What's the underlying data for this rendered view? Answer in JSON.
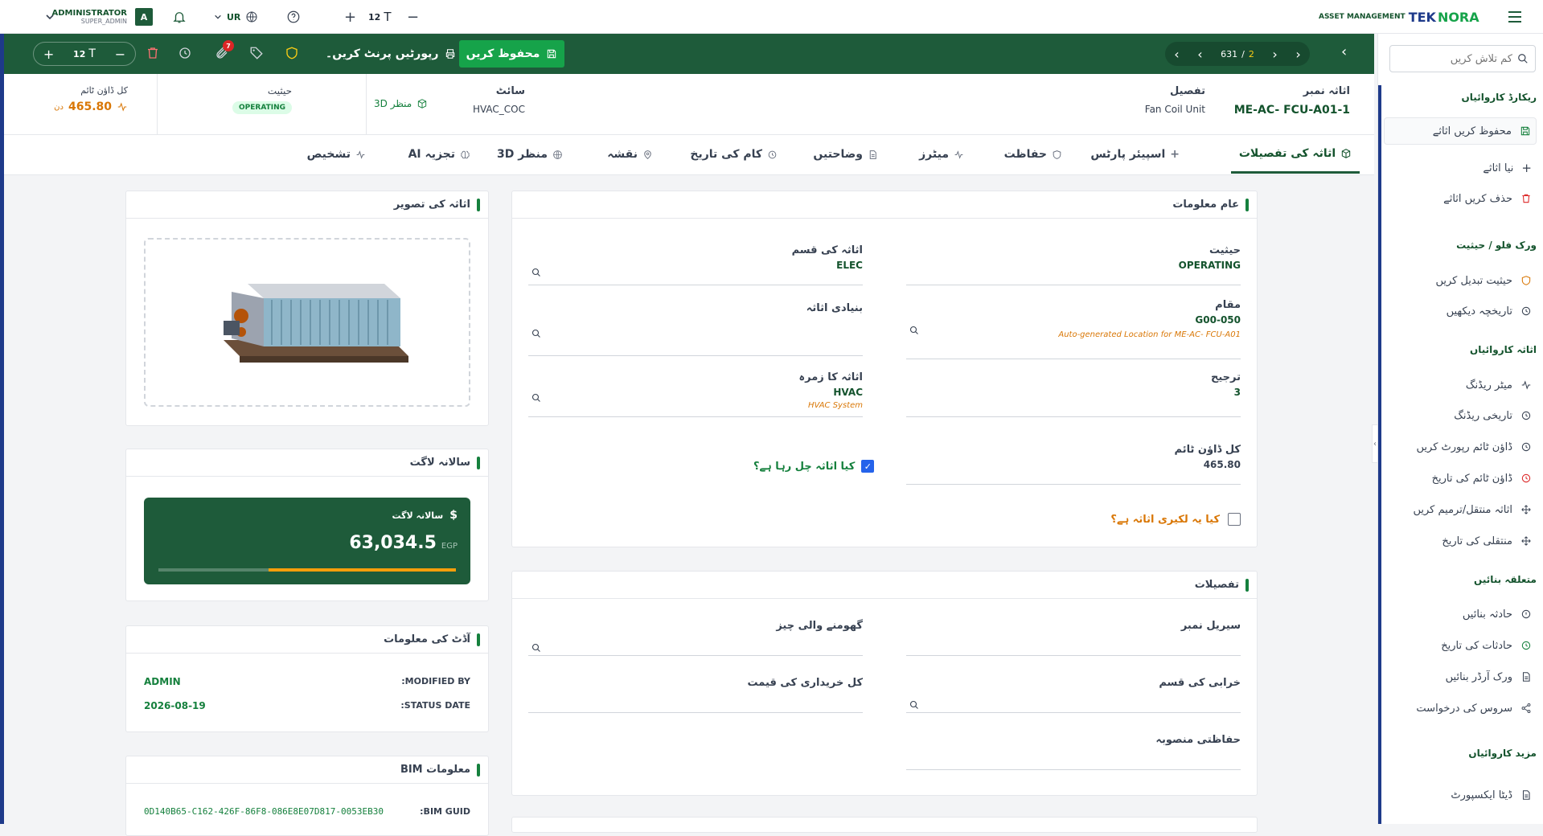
{
  "topbar": {
    "user_name": "ADMINISTRATOR",
    "user_role": "SUPER_ADMIN",
    "avatar_letter": "A",
    "lang": "UR",
    "font_size": "12",
    "brand_sub": "ASSET MANAGEMENT",
    "brand_pre": "TEK",
    "brand_post": "NORA"
  },
  "sidebar": {
    "search_placeholder": "کم تلاش کریں",
    "sections": [
      {
        "title": "ریکارڈ کاروائیاں",
        "items": [
          "محفوظ کریں اثاثے",
          "نیا اثاثے",
          "حذف کریں اثاثے"
        ]
      },
      {
        "title": "ورک فلو / حیثیت",
        "items": [
          "حیثیت تبدیل کریں",
          "تاریخچہ دیکھیں"
        ]
      },
      {
        "title": "اثاثہ کاروائیاں",
        "items": [
          "میٹر ریڈنگ",
          "تاریخی ریڈنگ",
          "ڈاؤن ٹائم رپورٹ کریں",
          "ڈاؤن ٹائم کی تاریخ",
          "اثاثہ منتقل/ترمیم کریں",
          "منتقلی کی تاریخ"
        ]
      },
      {
        "title": "متعلقہ بنائیں",
        "items": [
          "حادثہ بنائیں",
          "حادثات کی تاریخ",
          "ورک آرڈر بنائیں",
          "سروس کی درخواست"
        ]
      },
      {
        "title": "مزید کاروائیاں",
        "items": [
          "ڈیٹا ایکسپورٹ"
        ]
      }
    ]
  },
  "actionbar": {
    "save_label": "محفوظ کریں",
    "print_label": "رپورٹیں پرنٹ کریں۔",
    "page_current": "631",
    "page_total": "2",
    "attach_badge": "7",
    "font_size": "12"
  },
  "info": {
    "asset_no_label": "اثاثہ نمبر",
    "asset_no": "ME-AC- FCU-A01-1",
    "desc_label": "تفصیل",
    "desc": "Fan Coil Unit",
    "site_label": "سائٹ",
    "site": "HVAC_COC",
    "view3d": "3D منظر",
    "status_label": "حیثیت",
    "status": "OPERATING",
    "downtime_label": "کل ڈاؤن ٹائم",
    "downtime": "465.80",
    "downtime_unit": "دن"
  },
  "tabs": [
    "اثاثہ کی تفصیلات",
    "اسپیئر پارٹس",
    "حفاظت",
    "میٹرز",
    "وضاحتیں",
    "کام کی تاریخ",
    "نقشہ",
    "3D منظر",
    "AI تجزیہ",
    "تشخیص"
  ],
  "general": {
    "title": "عام معلومات",
    "status_label": "حیثیت",
    "status": "OPERATING",
    "class_label": "اثاثہ کی قسم",
    "class": "ELEC",
    "location_label": "مقام",
    "location": "G00-050",
    "location_note": "Auto-generated Location for ME-AC- FCU-A01",
    "parent_label": "بنیادی اثاثہ",
    "priority_label": "ترجیح",
    "priority": "3",
    "group_label": "اثاثہ کا زمرہ",
    "group": "HVAC",
    "group_note": "HVAC System",
    "downtime_label": "کل ڈاؤن ٹائم",
    "downtime": "465.80",
    "running_label": "کیا اثاثہ چل رہا ہے؟",
    "linear_label": "کیا یہ لکیری اثاثہ ہے؟"
  },
  "details": {
    "title": "تفصیلات",
    "serial_label": "سیریل نمبر",
    "rotating_label": "گھومنے والی چیز",
    "failure_label": "خرابی کی قسم",
    "purchase_label": "کل خریداری کی قیمت",
    "safety_label": "حفاظتی منصوبہ"
  },
  "image_card": {
    "title": "اثاثہ کی تصویر"
  },
  "cost_card": {
    "title": "سالانہ لاگت",
    "inner_label": "سالانہ لاگت",
    "value": "63,034.5",
    "currency": "EGP",
    "progress": 0.63
  },
  "audit_card": {
    "title": "آڈٹ کی معلومات",
    "modified_by_label": ":MODIFIED BY",
    "modified_by": "ADMIN",
    "status_date_label": ":STATUS DATE",
    "status_date": "2026-08-19"
  },
  "bim_card": {
    "title": "BIM معلومات",
    "guid_label": ":BIM GUID",
    "guid": "0D140B65-C162-426F-86F8-086E8E07D817-0053EB30"
  }
}
